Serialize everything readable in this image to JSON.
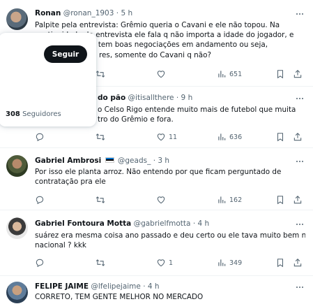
{
  "tweets": [
    {
      "name": "Ronan",
      "handle": "@ronan_1903",
      "dot": "·",
      "time": "5 h",
      "lines": [
        "Palpite pela entrevista: Grêmio queria o Cavani e ele não topou. Na",
        "continuidade da entrevista ele fala q não importa a idade do jogador, e",
        "o Grêmio tem boas negociações em andamento ou seja,",
        "res, somente do Cavani q não?"
      ],
      "stats": {
        "replies": "",
        "retweets": "",
        "likes": "",
        "views": "651"
      }
    },
    {
      "name": "do pão",
      "handle": "@itisallthere",
      "dot": "·",
      "time": "9 h",
      "lines": [
        "o Celso Rigo entende muito mais de futebol que muita",
        "tro do Grêmio e fora."
      ],
      "stats": {
        "replies": "",
        "retweets": "",
        "likes": "11",
        "views": "636"
      }
    },
    {
      "name": "Gabriel Ambrosi",
      "handle": "@geads_",
      "dot": "·",
      "time": "3 h",
      "lines": [
        "Por isso ele planta arroz. Não entendo por que ficam perguntado de",
        "contratação pra ele"
      ],
      "stats": {
        "replies": "",
        "retweets": "",
        "likes": "",
        "views": "162"
      }
    },
    {
      "name": "Gabriel Fontoura Motta",
      "handle": "@gabrielfmotta",
      "dot": "·",
      "time": "4 h",
      "lines": [
        "suárez era mesma coisa ano passado e deu certo ou ele tava muito bem no",
        "nacional ? kkk"
      ],
      "stats": {
        "replies": "",
        "retweets": "",
        "likes": "1",
        "views": "349"
      }
    },
    {
      "name": "FELIPE JAIME",
      "handle": "@lfelipejaime",
      "dot": "·",
      "time": "4 h",
      "lines": [
        "CORRETO, TEM GENTE MELHOR NO MERCADO"
      ]
    }
  ],
  "popover": {
    "follow_label": "Seguir",
    "followers_count": "308",
    "followers_label": "Seguidores"
  },
  "icons": {
    "more": "more-icon",
    "reply": "reply-icon",
    "retweet": "retweet-icon",
    "like": "heart-icon",
    "views": "views-icon",
    "bookmark": "bookmark-icon",
    "share": "share-icon"
  },
  "colors": {
    "text": "#0f1419",
    "secondary": "#536471",
    "border": "#eff3f4",
    "button": "#0f1419"
  }
}
